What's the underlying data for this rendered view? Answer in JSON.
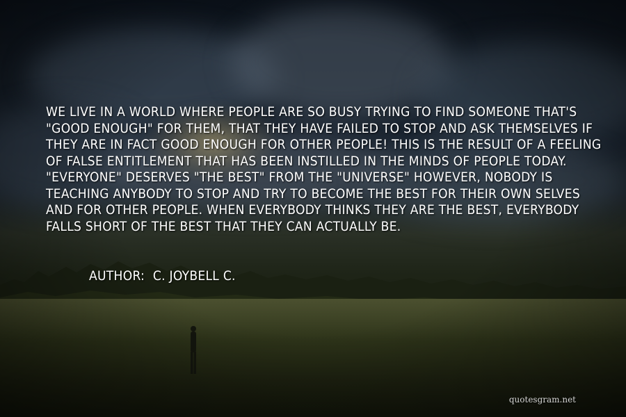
{
  "quote": {
    "lines": [
      "WE LIVE IN A WORLD WHERE PEOPLE ARE SO BUSY TRYING TO FIND SOMEONE THAT'S",
      "\"GOOD ENOUGH\" FOR THEM, THAT THEY HAVE FAILED TO STOP AND ASK THEMSELVES IF",
      "THEY ARE IN FACT GOOD ENOUGH FOR OTHER PEOPLE! THIS IS THE RESULT OF A FEELING",
      "OF FALSE ENTITLEMENT THAT HAS BEEN INSTILLED IN THE MINDS OF PEOPLE TODAY.",
      "\"EVERYONE\" DESERVES \"THE BEST\" FROM THE \"UNIVERSE\" HOWEVER, NOBODY IS",
      "TEACHING ANYBODY TO STOP AND TRY TO BECOME THE BEST FOR THEIR OWN SELVES",
      "AND FOR OTHER PEOPLE. WHEN EVERYBODY THINKS THEY ARE THE BEST, EVERYBODY",
      "FALLS SHORT OF THE BEST THAT THEY CAN ACTUALLY BE."
    ]
  },
  "author": {
    "label": "AUTHOR:",
    "name": "C. JOYBELL C."
  },
  "watermark": "quotesgram.net"
}
